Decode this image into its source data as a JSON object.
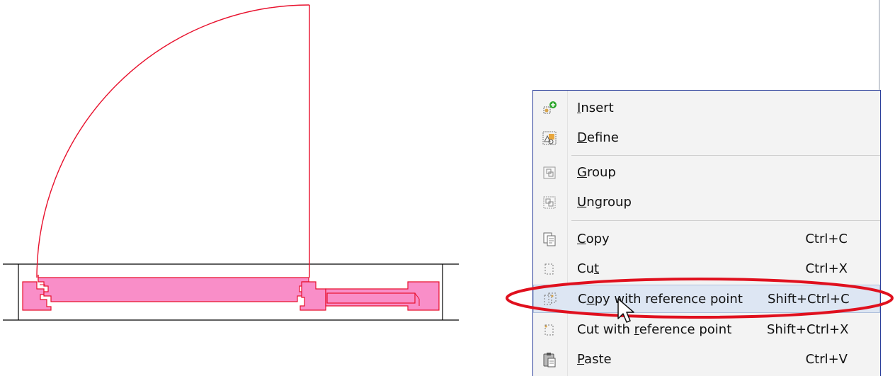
{
  "menu": {
    "items": [
      {
        "label_mnemonic": "I",
        "label_rest": "nsert",
        "shortcut": "",
        "icon": "insert-icon"
      },
      {
        "label_mnemonic": "D",
        "label_rest": "efine",
        "shortcut": "",
        "icon": "define-icon"
      },
      {
        "label_mnemonic": "G",
        "label_rest": "roup",
        "shortcut": "",
        "icon": "group-icon"
      },
      {
        "label_mnemonic": "U",
        "label_rest": "ngroup",
        "shortcut": "",
        "icon": "ungroup-icon"
      },
      {
        "label_mnemonic": "C",
        "label_rest": "opy",
        "shortcut": "Ctrl+C",
        "icon": "copy-icon"
      },
      {
        "label_pre": "Cu",
        "label_mnemonic": "t",
        "label_rest": "",
        "shortcut": "Ctrl+X",
        "icon": "cut-icon"
      },
      {
        "label_pre": "C",
        "label_mnemonic": "o",
        "label_rest": "py with reference point",
        "shortcut": "Shift+Ctrl+C",
        "icon": "copy-reference-icon"
      },
      {
        "label_pre": "Cut with ",
        "label_mnemonic": "r",
        "label_rest": "eference point",
        "shortcut": "Shift+Ctrl+X",
        "icon": "cut-reference-icon"
      },
      {
        "label_mnemonic": "P",
        "label_rest": "aste",
        "shortcut": "Ctrl+V",
        "icon": "paste-icon"
      }
    ]
  },
  "colors": {
    "door_outline": "#e8112d",
    "door_fill": "#f98ec8",
    "menu_border": "#2b3f9b",
    "highlight_ring": "#e0101e",
    "hover_bg": "#dde6f3"
  }
}
